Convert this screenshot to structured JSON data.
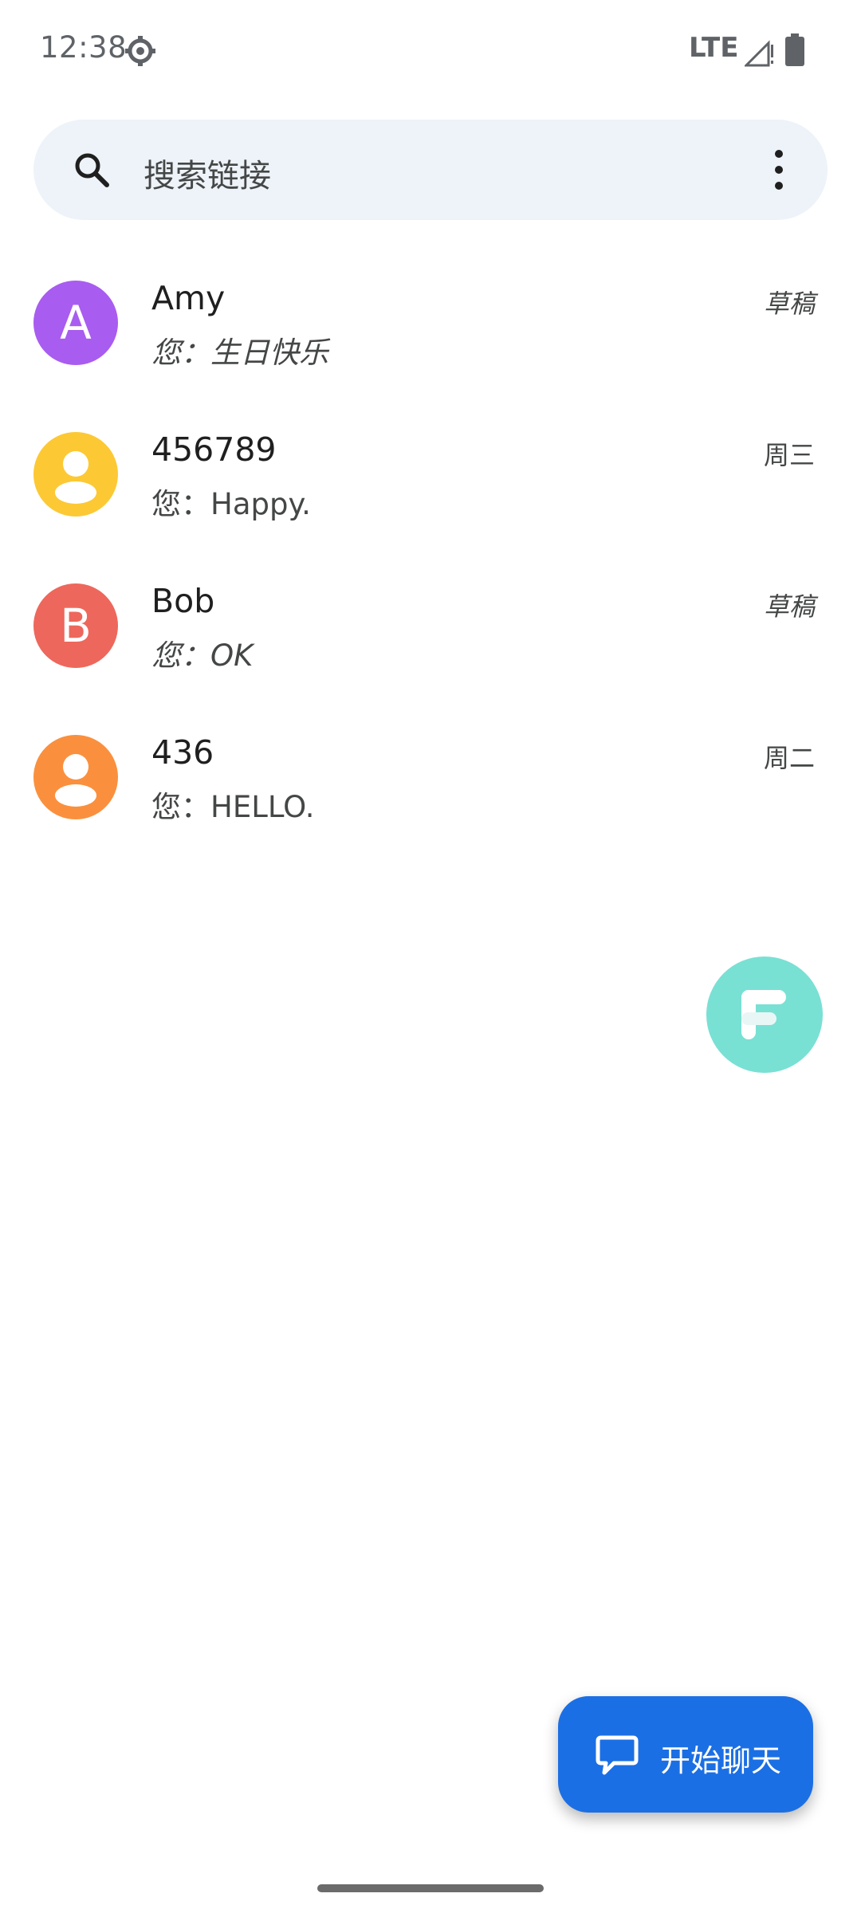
{
  "status_bar": {
    "time": "12:38",
    "network": "LTE",
    "icons": [
      "settings-gear-icon",
      "signal-icon",
      "battery-icon"
    ]
  },
  "search": {
    "placeholder": "搜索链接",
    "icons": [
      "search-icon",
      "more-options-icon"
    ]
  },
  "conversations": [
    {
      "name": "Amy",
      "avatar_letter": "A",
      "avatar_color": "#a95cf0",
      "snippet": "您：生日快乐",
      "time": "草稿",
      "is_draft": true
    },
    {
      "name": "456789",
      "avatar_letter": "",
      "avatar_icon": "person-icon",
      "avatar_color": "#fcc934",
      "snippet": "您：Happy.",
      "time": "周三",
      "is_draft": false
    },
    {
      "name": "Bob",
      "avatar_letter": "B",
      "avatar_color": "#ee675c",
      "snippet": "您：OK",
      "time": "草稿",
      "is_draft": true
    },
    {
      "name": "436",
      "avatar_letter": "",
      "avatar_icon": "person-icon",
      "avatar_color": "#fa903e",
      "snippet": "您：HELLO.",
      "time": "周二",
      "is_draft": false
    }
  ],
  "floating_bubble": {
    "icon": "f-logo-icon",
    "color": "#79e0d4"
  },
  "fab": {
    "label": "开始聊天",
    "icon": "chat-bubble-icon",
    "color": "#1b6fe4"
  }
}
